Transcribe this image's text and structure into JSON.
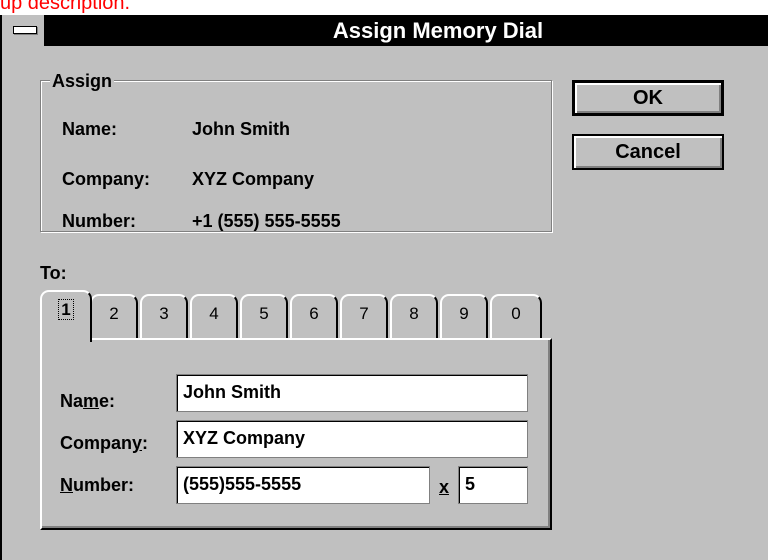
{
  "caption": "up description.",
  "window": {
    "title": "Assign Memory Dial"
  },
  "assign_group": {
    "legend": "Assign",
    "name_label": "Name:",
    "name_value": "John Smith",
    "company_label": "Company:",
    "company_value": "XYZ Company",
    "number_label": "Number:",
    "number_value": "+1 (555) 555-5555"
  },
  "to_label": "To:",
  "buttons": {
    "ok": "OK",
    "cancel": "Cancel"
  },
  "tabs": [
    "1",
    "2",
    "3",
    "4",
    "5",
    "6",
    "7",
    "8",
    "9",
    "0"
  ],
  "active_tab": "1",
  "form": {
    "name_label_a": "Na",
    "name_label_u": "m",
    "name_label_b": "e:",
    "name_value": "John Smith",
    "company_label_a": "Compan",
    "company_label_u": "y",
    "company_label_b": ":",
    "company_value": "XYZ Company",
    "number_label_u": "N",
    "number_label_b": "umber:",
    "number_value": "(555)555-5555",
    "ext_label": "x",
    "ext_value": "5"
  }
}
